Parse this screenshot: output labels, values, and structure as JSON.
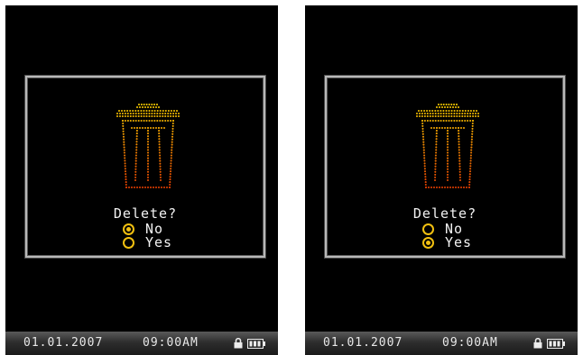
{
  "screens": [
    {
      "dialog": {
        "prompt": "Delete?",
        "options": [
          {
            "label": "No",
            "selected": true
          },
          {
            "label": "Yes",
            "selected": false
          }
        ]
      },
      "status": {
        "date": "01.01.2007",
        "time": "09:00AM"
      }
    },
    {
      "dialog": {
        "prompt": "Delete?",
        "options": [
          {
            "label": "No",
            "selected": false
          },
          {
            "label": "Yes",
            "selected": true
          }
        ]
      },
      "status": {
        "date": "01.01.2007",
        "time": "09:00AM"
      }
    }
  ],
  "icons": [
    "trash-icon",
    "lock-icon",
    "battery-icon",
    "radio-selected-icon",
    "radio-unselected-icon"
  ],
  "colors": {
    "screen_bg": "#000000",
    "dialog_border": "#b8b8b8",
    "text": "#f2f2f2",
    "radio": "#f2c010",
    "trash_top": "#f7d000",
    "trash_bottom": "#e03a00"
  }
}
